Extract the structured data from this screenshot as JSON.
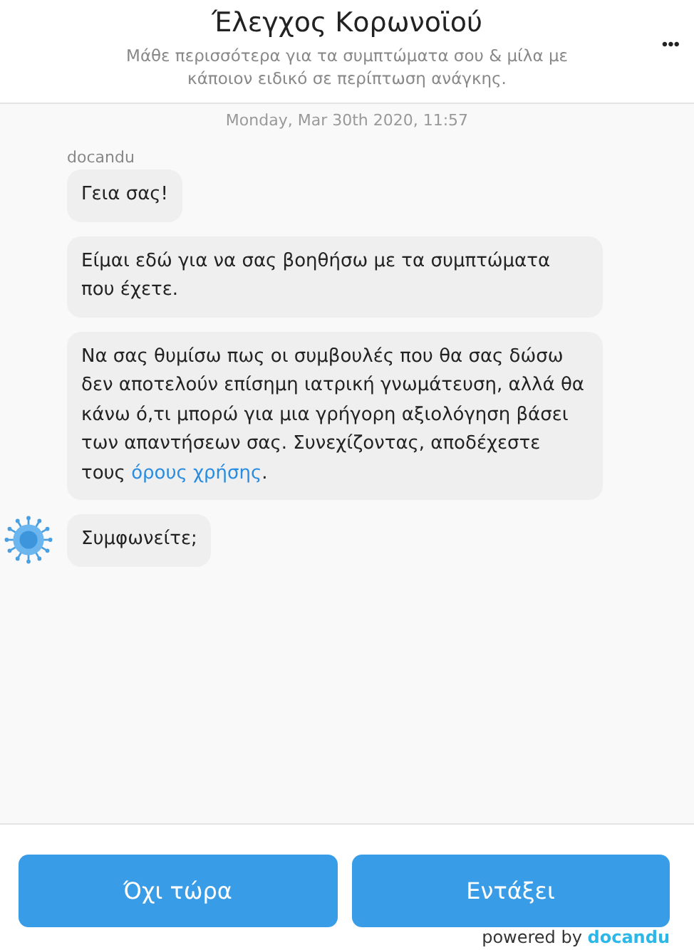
{
  "header": {
    "title": "Έλεγχος Κορωνοϊού",
    "subtitle": "Μάθε περισσότερα για τα συμπτώματα σου & μίλα με κάποιον ειδικό σε περίπτωση ανάγκης.",
    "menu": "•••"
  },
  "chat": {
    "timestamp": "Monday, Mar 30th 2020, 11:57",
    "sender": "docandu",
    "messages": [
      {
        "text": "Γεια σας!"
      },
      {
        "text": "Είμαι εδώ για να σας βοηθήσω με τα συμπτώματα που έχετε."
      },
      {
        "text": "Να σας θυμίσω πως οι συμβουλές που θα σας δώσω δεν αποτελούν επίσημη ιατρική γνωμάτευση, αλλά θα κάνω ό,τι μπορώ για μια γρήγορη αξιολόγηση βάσει των απαντήσεων σας. Συνεχίζοντας, αποδέχεστε τους ",
        "link": "όρους χρήσης",
        "after": "."
      },
      {
        "text": "Συμφωνείτε;",
        "avatar": true
      }
    ]
  },
  "buttons": [
    "Όχι τώρα",
    "Εντάξει"
  ],
  "footer": {
    "prefix": "powered by",
    "brand": "docandu"
  }
}
